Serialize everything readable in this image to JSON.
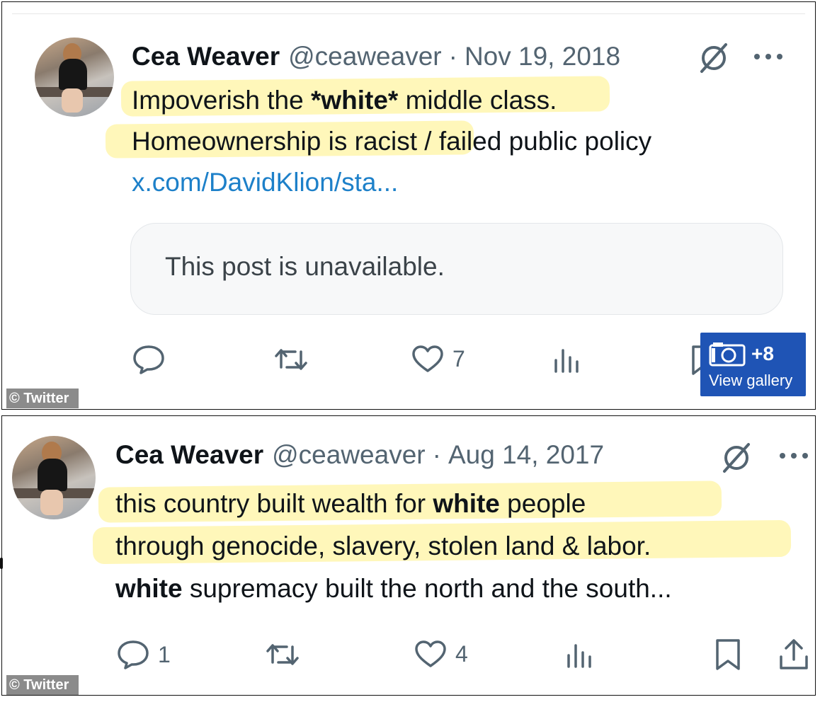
{
  "posts": [
    {
      "author_name": "Cea Weaver",
      "handle": "@ceaweaver",
      "separator": "·",
      "date": "Nov 19, 2018",
      "lines": {
        "l1_pre": "Impoverish the ",
        "l1_bold": "*white*",
        "l1_post": " middle class.",
        "l2": "Homeownership is racist / failed public policy",
        "link": "x.com/DavidKlion/sta..."
      },
      "quote_text": "This post is unavailable.",
      "actions": {
        "reply_count": "",
        "repost_count": "",
        "like_count": "7"
      },
      "credit": "© Twitter"
    },
    {
      "author_name": "Cea Weaver",
      "handle": "@ceaweaver",
      "separator": "·",
      "date": "Aug 14, 2017",
      "lines": {
        "l1_pre": "this country built wealth for ",
        "l1_bold": "white",
        "l1_post": " people",
        "l2": "through genocide, slavery, stolen land & labor.",
        "l3_bold": "white",
        "l3_post": " supremacy built the north and the south..."
      },
      "actions": {
        "reply_count": "1",
        "repost_count": "",
        "like_count": "4"
      },
      "credit": "© Twitter"
    }
  ],
  "gallery": {
    "count": "+8",
    "label": "View gallery"
  },
  "colors": {
    "text": "#0f1419",
    "secondary": "#536471",
    "link": "#1d80c9",
    "highlight": "#fff182",
    "gallery_bg": "#1f54b5"
  }
}
